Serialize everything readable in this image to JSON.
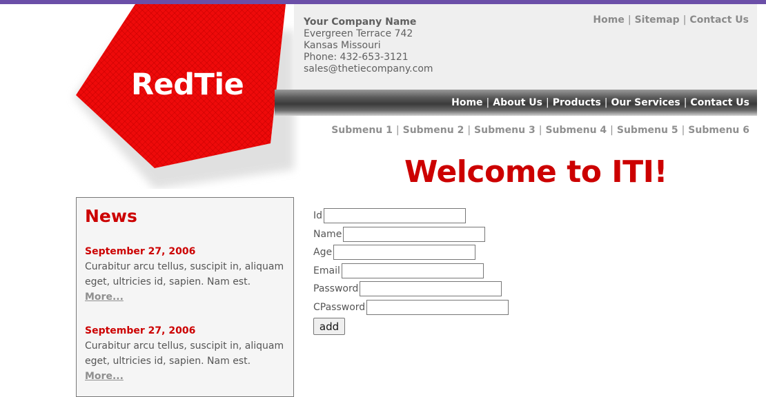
{
  "logo": {
    "text": "RedTie",
    "color": "#e60000"
  },
  "company": {
    "name": "Your Company Name",
    "address1": "Evergreen Terrace 742",
    "address2": "Kansas Missouri",
    "phone": "Phone: 432-653-3121",
    "email": "sales@thetiecompany.com"
  },
  "top_links": [
    "Home",
    "Sitemap",
    "Contact Us"
  ],
  "nav_links": [
    "Home",
    "About Us",
    "Products",
    "Our Services",
    "Contact Us"
  ],
  "submenu": [
    "Submenu 1",
    "Submenu 2",
    "Submenu 3",
    "Submenu 4",
    "Submenu 5",
    "Submenu 6"
  ],
  "separator": "|",
  "welcome": "Welcome to ITI!",
  "news": {
    "title": "News",
    "items": [
      {
        "date": "September 27, 2006",
        "body": "Curabitur arcu tellus, suscipit in, aliquam eget, ultricies id, sapien. Nam est.",
        "more": "More..."
      },
      {
        "date": "September 27, 2006",
        "body": "Curabitur arcu tellus, suscipit in, aliquam eget, ultricies id, sapien. Nam est.",
        "more": "More..."
      }
    ]
  },
  "form": {
    "fields": [
      {
        "label": "Id",
        "value": ""
      },
      {
        "label": "Name",
        "value": ""
      },
      {
        "label": "Age",
        "value": ""
      },
      {
        "label": "Email",
        "value": ""
      },
      {
        "label": "Password",
        "value": ""
      },
      {
        "label": "CPassword",
        "value": ""
      }
    ],
    "submit_label": "add"
  },
  "colors": {
    "accent": "#cc0000",
    "top_bar": "#6b4fa8",
    "link_grey": "#8f8f8f"
  }
}
